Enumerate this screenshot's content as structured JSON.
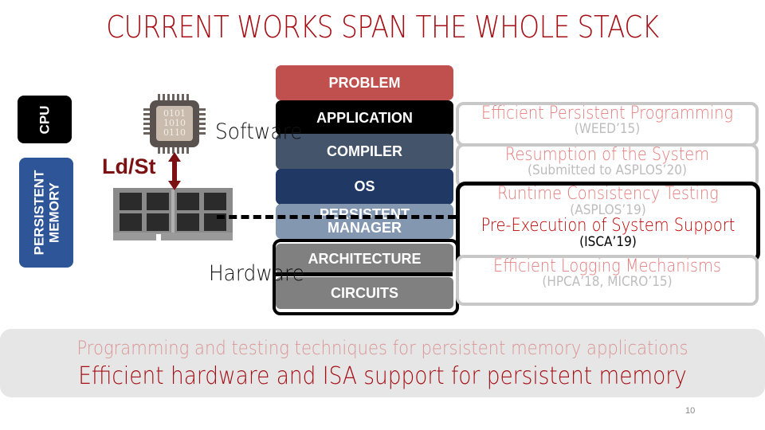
{
  "slide": {
    "title": "CURRENT WORKS SPAN THE WHOLE STACK",
    "page_number": "10"
  },
  "left_tags": {
    "cpu": "CPU",
    "persistent_memory": "PERSISTENT\nMEMORY"
  },
  "illustration": {
    "chip_bits": [
      "0101",
      "1010",
      "0110"
    ],
    "ld_st_label": "Ld/St",
    "software_label": "Software",
    "hardware_label": "Hardware"
  },
  "stack_layers": [
    {
      "label": "PROBLEM",
      "color": "#c0504d"
    },
    {
      "label": "APPLICATION",
      "color": "#000000"
    },
    {
      "label": "COMPILER",
      "color": "#44546a"
    },
    {
      "label": "OS",
      "color": "#1f3864"
    },
    {
      "label": "PERSISTENT",
      "label2": "MANAGER",
      "color": "#8497b0"
    },
    {
      "label": "ARCHITECTURE",
      "color": "#808080"
    },
    {
      "label": "CIRCUITS",
      "color": "#808080"
    }
  ],
  "works": [
    {
      "title": "Efficient Persistent Programming",
      "venue": "(WEED’15)"
    },
    {
      "title": "Resumption of the System",
      "venue": "(Submitted to ASPLOS’20)"
    },
    {
      "title": "Runtime Consistency Testing",
      "venue": "(ASPLOS’19)"
    },
    {
      "title": "Pre-Execution of System Support",
      "venue": "(ISCA’19)"
    },
    {
      "title": "Efficient Logging Mechanisms",
      "venue": "(HPCA’18, MICRO’15)"
    }
  ],
  "summary": {
    "line1": "Programming and testing techniques for persistent memory applications",
    "line2": "Efficient hardware and ISA support for persistent memory"
  },
  "colors": {
    "title_red": "#a50f15",
    "cpu_tag": "#000000",
    "pm_tag": "#2e5597",
    "ldst": "#7b1113",
    "faded_title": "#e67b7b",
    "faded_venue": "#bdbdbd",
    "highlight_title": "#c00000"
  }
}
